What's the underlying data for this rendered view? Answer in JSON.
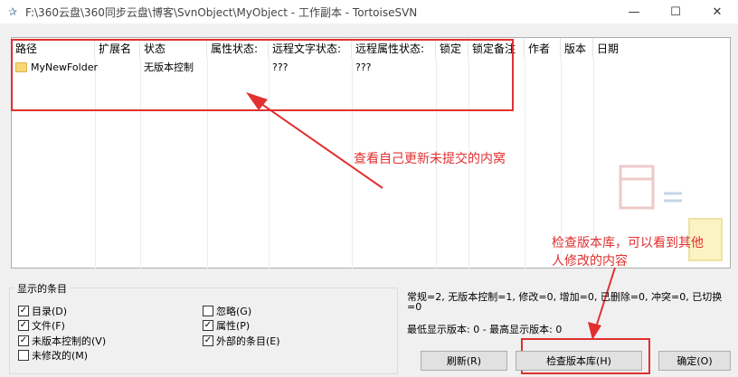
{
  "window": {
    "title": "F:\\360云盘\\360同步云盘\\博客\\SvnObject\\MyObject - 工作副本 - TortoiseSVN",
    "minimize": "—",
    "maximize": "☐",
    "close": "✕"
  },
  "list": {
    "columns": [
      "路径",
      "扩展名",
      "状态",
      "属性状态:",
      "远程文字状态:",
      "远程属性状态:",
      "锁定",
      "锁定备注",
      "作者",
      "版本",
      "日期"
    ],
    "rows": [
      {
        "path": "MyNewFolder",
        "ext": "",
        "status": "无版本控制",
        "prop_status": "",
        "remote_text": "???",
        "remote_prop": "???"
      }
    ]
  },
  "annotations": {
    "note1": "查看自己更新未提交的内窝",
    "note2_line1": "检查版本库，可以看到其他",
    "note2_line2": "人修改的内容"
  },
  "show_items": {
    "title": "显示的条目",
    "items": [
      {
        "label": "目录(D)",
        "checked": true
      },
      {
        "label": "文件(F)",
        "checked": true
      },
      {
        "label": "未版本控制的(V)",
        "checked": true
      },
      {
        "label": "未修改的(M)",
        "checked": false
      },
      {
        "label": "忽略(G)",
        "checked": false
      },
      {
        "label": "属性(P)",
        "checked": true
      },
      {
        "label": "外部的条目(E)",
        "checked": true
      }
    ]
  },
  "status": {
    "summary_line1": "常规=2, 无版本控制=1, 修改=0, 增加=0, 已删除=0, 冲突=0, 已切换",
    "summary_line2": "=0",
    "versions": "最低显示版本: 0 - 最高显示版本: 0"
  },
  "buttons": {
    "refresh": "刷新(R)",
    "check_repo": "检查版本库(H)",
    "ok": "确定(O)"
  },
  "colors": {
    "annotation": "#e03030",
    "folder": "#f8d775"
  }
}
